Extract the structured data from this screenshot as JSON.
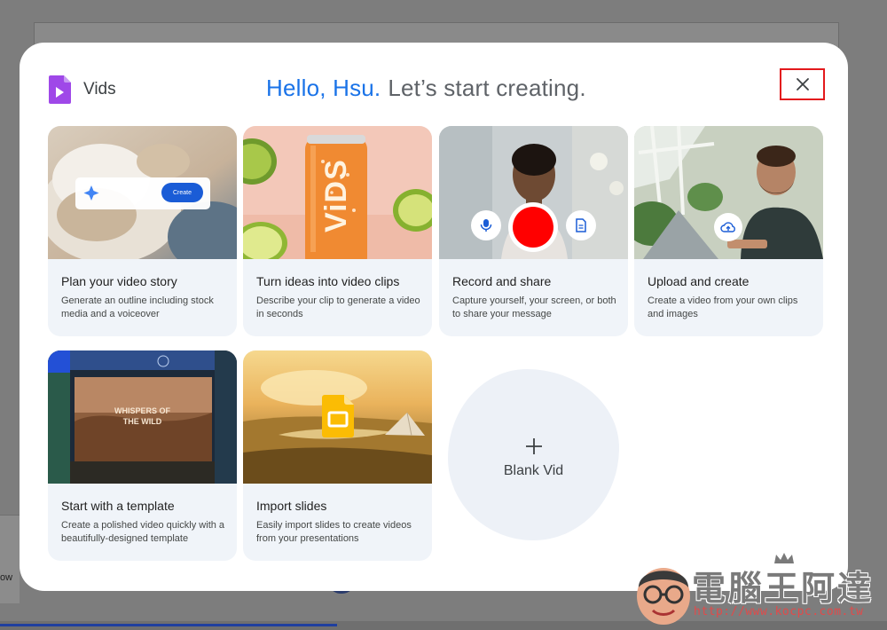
{
  "background": {
    "partial_text": "ow"
  },
  "app": {
    "name": "Vids",
    "brand_color": "#9f48e8"
  },
  "header": {
    "greeting": "Hello, Hsu.",
    "subtitle": "Let’s start creating."
  },
  "close_button": {
    "icon": "close-icon",
    "highlight_color": "#e3191c"
  },
  "cards": [
    {
      "title": "Plan your video story",
      "description": "Generate an outline including stock media and a voiceover",
      "media_button": "Create"
    },
    {
      "title": "Turn ideas into video clips",
      "description": "Describe your clip to generate a video in seconds",
      "can_text": "ViDS"
    },
    {
      "title": "Record and share",
      "description": "Capture yourself, your screen, or both to share your message",
      "controls": [
        "microphone-icon",
        "record-button",
        "document-icon"
      ]
    },
    {
      "title": "Upload and create",
      "description": "Create a video from your own clips and images",
      "media_icon": "cloud-upload-icon"
    },
    {
      "title": "Start with a template",
      "description": "Create a polished video quickly with a beautifully-designed template",
      "poster_text_1": "WHISPERS OF",
      "poster_text_2": "THE WILD"
    },
    {
      "title": "Import slides",
      "description": "Easily import slides to create videos from your presentations",
      "media_icon": "slides-icon"
    }
  ],
  "blank": {
    "label": "Blank Vid",
    "icon": "plus-icon"
  },
  "watermark": {
    "title": "電腦王阿達",
    "url": "http://www.kocpc.com.tw"
  }
}
